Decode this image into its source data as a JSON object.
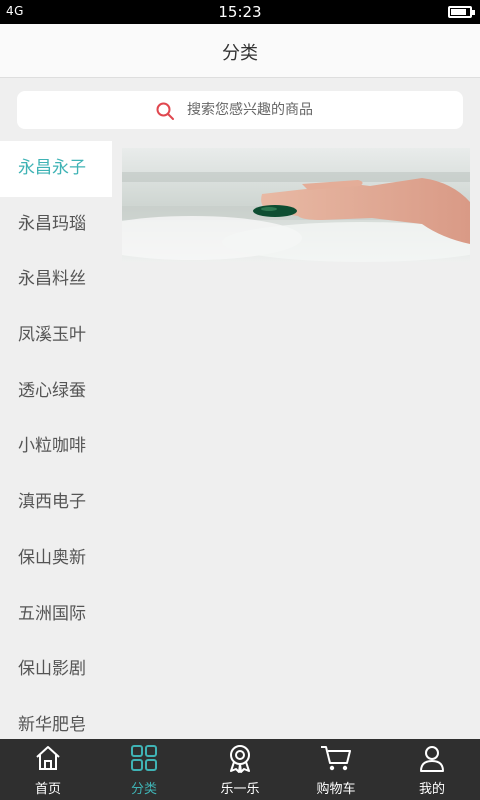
{
  "status_bar": {
    "network": "4G",
    "time": "15:23",
    "battery_level": 0.85
  },
  "header": {
    "title": "分类"
  },
  "search": {
    "placeholder": "搜索您感兴趣的商品"
  },
  "sidebar": {
    "items": [
      {
        "label": "永昌永子",
        "active": true
      },
      {
        "label": "永昌玛瑙",
        "active": false
      },
      {
        "label": "永昌料丝",
        "active": false
      },
      {
        "label": "凤溪玉叶",
        "active": false
      },
      {
        "label": "透心绿蚕",
        "active": false
      },
      {
        "label": "小粒咖啡",
        "active": false
      },
      {
        "label": "滇西电子",
        "active": false
      },
      {
        "label": "保山奥新",
        "active": false
      },
      {
        "label": "五洲国际",
        "active": false
      },
      {
        "label": "保山影剧",
        "active": false
      },
      {
        "label": "新华肥皂",
        "active": false
      }
    ]
  },
  "colors": {
    "accent": "#3fb3b5",
    "tabbar_bg": "#2f2f2f"
  },
  "tabbar": {
    "tabs": [
      {
        "label": "首页",
        "icon": "home-icon",
        "active": false
      },
      {
        "label": "分类",
        "icon": "grid-icon",
        "active": true
      },
      {
        "label": "乐一乐",
        "icon": "award-icon",
        "active": false
      },
      {
        "label": "购物车",
        "icon": "cart-icon",
        "active": false
      },
      {
        "label": "我的",
        "icon": "user-icon",
        "active": false
      }
    ]
  }
}
